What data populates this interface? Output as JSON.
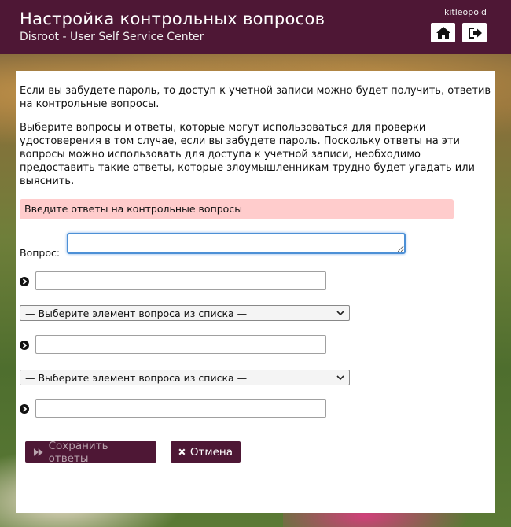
{
  "header": {
    "title": "Настройка контрольных вопросов",
    "subtitle": "Disroot - User Self Service Center",
    "username": "kitleopold",
    "home_icon": "home-icon",
    "logout_icon": "sign-out-icon"
  },
  "content": {
    "paragraph1": "Если вы забудете пароль, то доступ к учетной записи можно будет получить, ответив на контрольные вопросы.",
    "paragraph2": "Выберите вопросы и ответы, которые могут использоваться для проверки удостоверения в том случае, если вы забудете пароль. Поскольку ответы на эти вопросы можно использовать для доступа к учетной записи, необходимо предоставить такие ответы, которые злоумышленникам трудно будет угадать или выяснить.",
    "alert": "Введите ответы на контрольные вопросы"
  },
  "form": {
    "question_label": "Вопрос:",
    "question_value": "",
    "answer1_value": "",
    "select2": "— Выберите элемент вопроса из списка —",
    "answer2_value": "",
    "select3": "— Выберите элемент вопроса из списка —",
    "answer3_value": ""
  },
  "buttons": {
    "save_label": "Сохранить ответы",
    "cancel_label": "Отмена"
  },
  "colors": {
    "header_bg": "#4e1735",
    "alert_bg": "#ffcccc",
    "focus_border": "#4d90d6"
  }
}
